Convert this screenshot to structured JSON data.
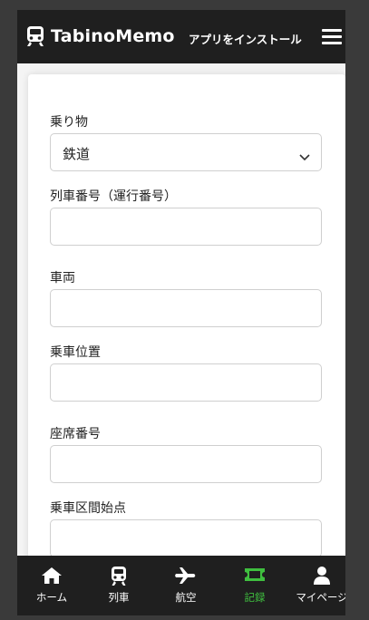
{
  "header": {
    "app_name": "TabinoMemo",
    "install_label": "アプリをインストール"
  },
  "form": {
    "vehicle_label": "乗り物",
    "vehicle_value": "鉄道",
    "train_number_label": "列車番号（運行番号）",
    "car_label": "車両",
    "position_label": "乗車位置",
    "seat_label": "座席番号",
    "start_label": "乗車区間始点"
  },
  "nav": {
    "items": [
      {
        "label": "ホーム",
        "icon": "home-icon"
      },
      {
        "label": "列車",
        "icon": "train-icon"
      },
      {
        "label": "航空",
        "icon": "plane-icon"
      },
      {
        "label": "記録",
        "icon": "ticket-icon"
      },
      {
        "label": "マイページ",
        "icon": "user-icon"
      }
    ],
    "active_index": 3,
    "active_color": "#3fbf3f"
  }
}
